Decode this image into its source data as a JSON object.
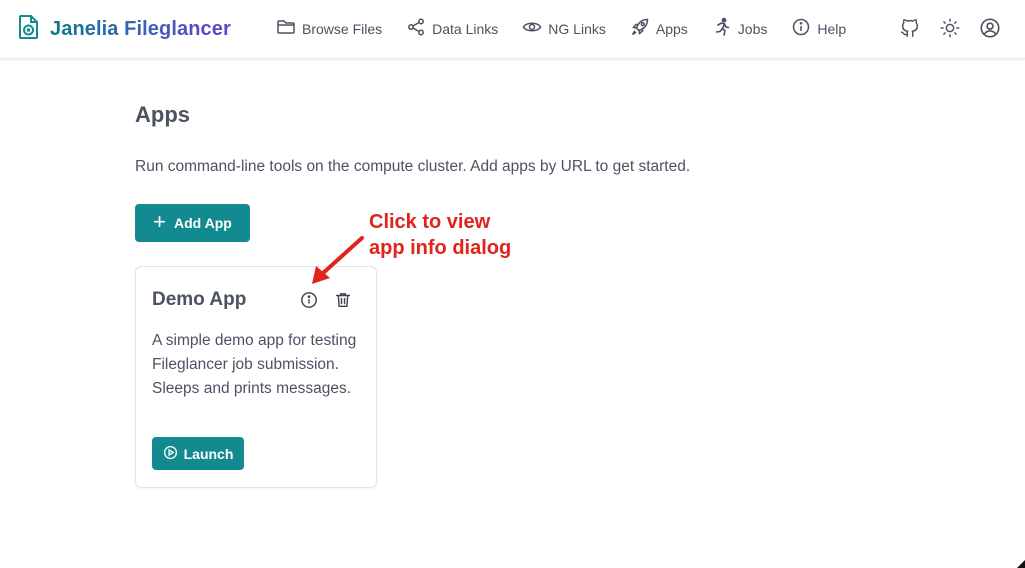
{
  "app": {
    "title": "Janelia Fileglancer",
    "logo_icon": "file-eye-icon",
    "brand_colors": [
      "#0f7a8a",
      "#3d5fbf",
      "#6a3fc8"
    ]
  },
  "nav": {
    "items": [
      {
        "label": "Browse Files",
        "icon": "folder-icon"
      },
      {
        "label": "Data Links",
        "icon": "share-icon"
      },
      {
        "label": "NG Links",
        "icon": "eye-icon"
      },
      {
        "label": "Apps",
        "icon": "rocket-icon"
      },
      {
        "label": "Jobs",
        "icon": "running-person-icon"
      },
      {
        "label": "Help",
        "icon": "info-circle-icon"
      }
    ],
    "right_icons": [
      "github-icon",
      "sun-icon",
      "user-circle-icon"
    ]
  },
  "page": {
    "title": "Apps",
    "description": "Run command-line tools on the compute cluster. Add apps by URL to get started.",
    "add_button_label": "Add App"
  },
  "cards": [
    {
      "title": "Demo App",
      "description": "A simple demo app for testing Fileglancer job submission. Sleeps and prints messages.",
      "launch_label": "Launch",
      "icons": [
        "info-circle-icon",
        "trash-icon"
      ]
    }
  ],
  "annotation": {
    "line1": "Click to view",
    "line2": "app info dialog",
    "color": "#e0231b"
  },
  "colors": {
    "accent": "#138a8f",
    "text": "#4b5260"
  }
}
